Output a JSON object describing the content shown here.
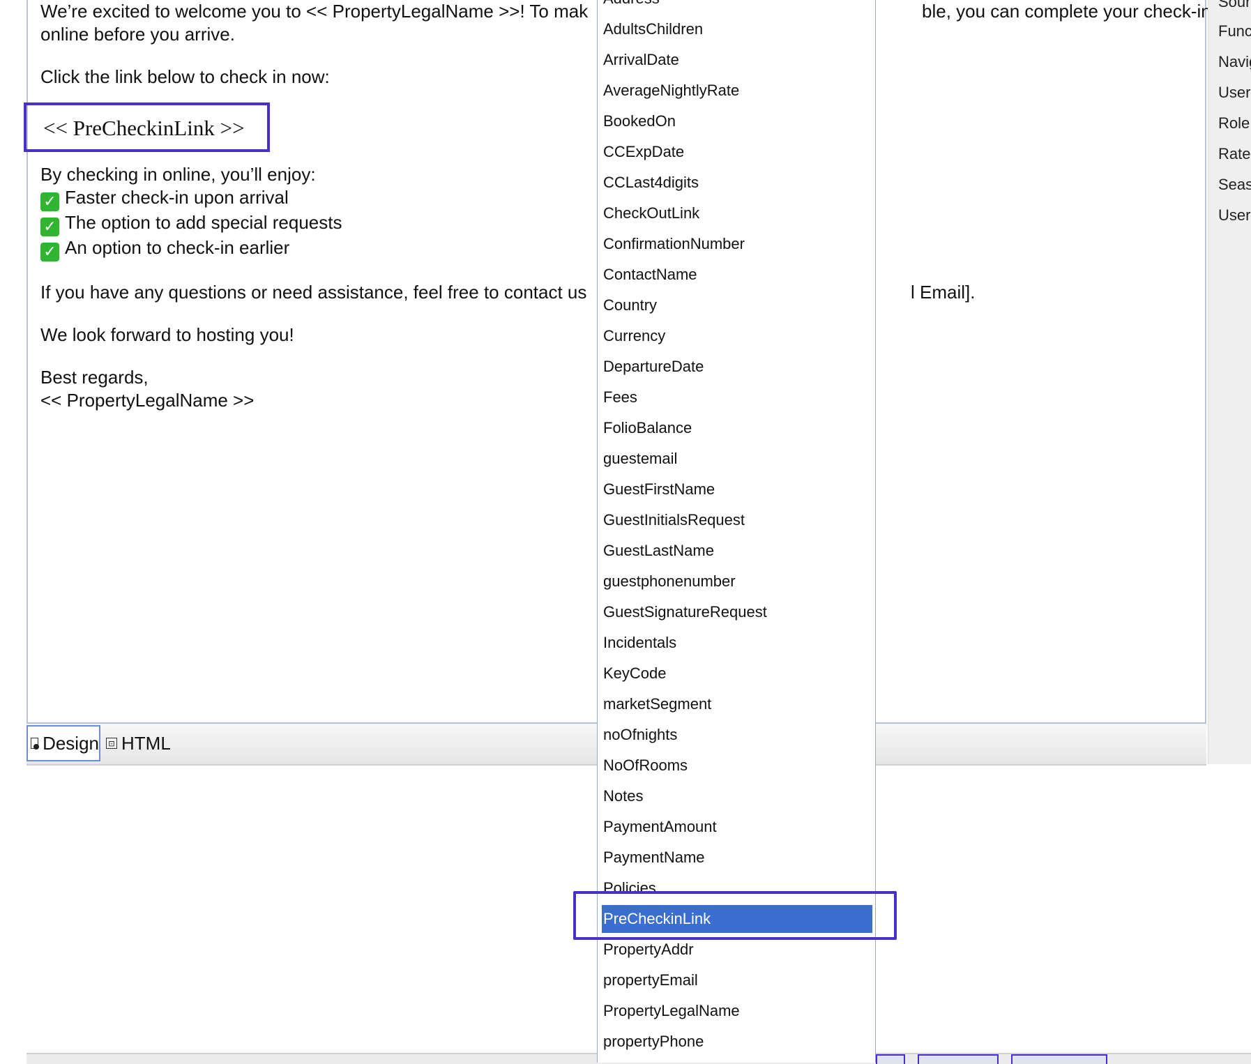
{
  "email": {
    "line1a": "We’re excited to welcome you to << PropertyLegalName >>! To mak",
    "line1b": "ble, you can complete your check-in",
    "line2": "online before you arrive.",
    "click_line": "Click the link below to check in now:",
    "link_token": "<< PreCheckinLink >>",
    "enjoy_intro": "By checking in online, you’ll enjoy:",
    "benefits": [
      "Faster check-in upon arrival",
      "The option to add special requests",
      "An option to check-in earlier"
    ],
    "questions_a": "If you have any questions or need assistance, feel free to contact us",
    "questions_b": "l Email].",
    "closing": "We look forward to hosting you!",
    "regards": "Best regards,",
    "signature": "<< PropertyLegalName >>"
  },
  "tabs": {
    "design": "Design",
    "html": "HTML"
  },
  "sidebar": {
    "items": [
      "Sourc",
      "Funct",
      "Navig",
      "UserI",
      "RoleI",
      "RateI",
      "Seaso",
      "UserI"
    ]
  },
  "dropdown": {
    "options": [
      "Address",
      "AdultsChildren",
      "ArrivalDate",
      "AverageNightlyRate",
      "BookedOn",
      "CCExpDate",
      "CCLast4digits",
      "CheckOutLink",
      "ConfirmationNumber",
      "ContactName",
      "Country",
      "Currency",
      "DepartureDate",
      "Fees",
      "FolioBalance",
      "guestemail",
      "GuestFirstName",
      "GuestInitialsRequest",
      "GuestLastName",
      "guestphonenumber",
      "GuestSignatureRequest",
      "Incidentals",
      "KeyCode",
      "marketSegment",
      "noOfnights",
      "NoOfRooms",
      "Notes",
      "PaymentAmount",
      "PaymentName",
      "Policies",
      "PreCheckinLink",
      "PropertyAddr",
      "propertyEmail",
      "PropertyLegalName",
      "propertyPhone"
    ],
    "selected": "PreCheckinLink",
    "selected_color": "#3a6fcf",
    "highlight_color": "#4a2fc8"
  }
}
